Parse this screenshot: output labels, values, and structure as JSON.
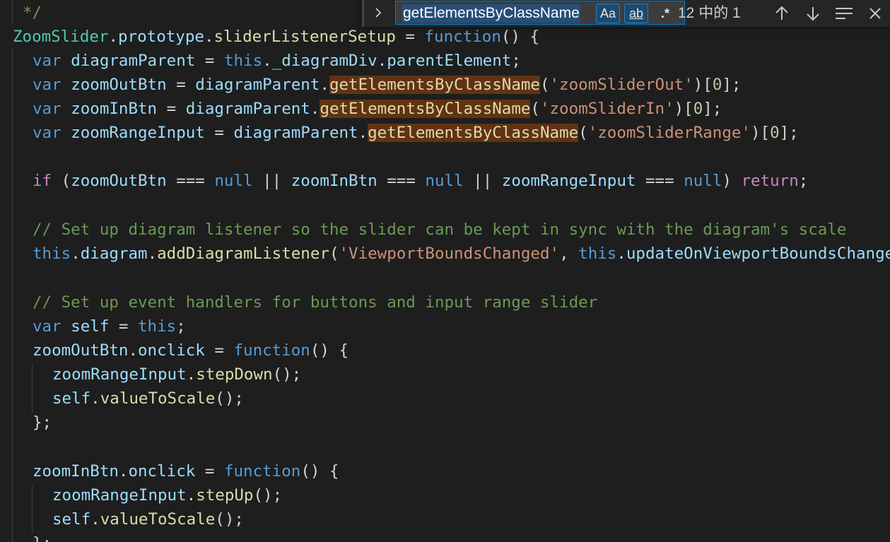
{
  "editor": {
    "lines": [
      [
        [
          "*/",
          "cmt"
        ]
      ],
      [
        [
          "ZoomSlider",
          "cls"
        ],
        [
          ".",
          "punc"
        ],
        [
          "prototype",
          "name"
        ],
        [
          ".",
          "punc"
        ],
        [
          "sliderListenerSetup",
          "fn"
        ],
        [
          " = ",
          "punc"
        ],
        [
          "function",
          "var"
        ],
        [
          "() {",
          "punc"
        ]
      ],
      [
        [
          "var",
          "var"
        ],
        [
          " ",
          "punc"
        ],
        [
          "diagramParent",
          "name"
        ],
        [
          " = ",
          "punc"
        ],
        [
          "this",
          "var"
        ],
        [
          ".",
          "punc"
        ],
        [
          "_diagramDiv",
          "name"
        ],
        [
          ".",
          "punc"
        ],
        [
          "parentElement",
          "name"
        ],
        [
          ";",
          "punc"
        ]
      ],
      [
        [
          "var",
          "var"
        ],
        [
          " ",
          "punc"
        ],
        [
          "zoomOutBtn",
          "name"
        ],
        [
          " = ",
          "punc"
        ],
        [
          "diagramParent",
          "name"
        ],
        [
          ".",
          "punc"
        ],
        [
          "getElementsByClassName",
          "fn",
          "match"
        ],
        [
          "(",
          "punc"
        ],
        [
          "'zoomSliderOut'",
          "str"
        ],
        [
          ")[",
          "punc"
        ],
        [
          "0",
          "num"
        ],
        [
          "];",
          "punc"
        ]
      ],
      [
        [
          "var",
          "var"
        ],
        [
          " ",
          "punc"
        ],
        [
          "zoomInBtn",
          "name"
        ],
        [
          " = ",
          "punc"
        ],
        [
          "diagramParent",
          "name"
        ],
        [
          ".",
          "punc"
        ],
        [
          "getElementsByClassName",
          "fn",
          "match"
        ],
        [
          "(",
          "punc"
        ],
        [
          "'zoomSliderIn'",
          "str"
        ],
        [
          ")[",
          "punc"
        ],
        [
          "0",
          "num"
        ],
        [
          "];",
          "punc"
        ]
      ],
      [
        [
          "var",
          "var"
        ],
        [
          " ",
          "punc"
        ],
        [
          "zoomRangeInput",
          "name"
        ],
        [
          " = ",
          "punc"
        ],
        [
          "diagramParent",
          "name"
        ],
        [
          ".",
          "punc"
        ],
        [
          "getElementsByClassName",
          "fn",
          "match"
        ],
        [
          "(",
          "punc"
        ],
        [
          "'zoomSliderRange'",
          "str"
        ],
        [
          ")[",
          "punc"
        ],
        [
          "0",
          "num"
        ],
        [
          "];",
          "punc"
        ]
      ],
      [],
      [
        [
          "if",
          "ctl"
        ],
        [
          " (",
          "punc"
        ],
        [
          "zoomOutBtn",
          "name"
        ],
        [
          " === ",
          "punc"
        ],
        [
          "null",
          "var"
        ],
        [
          " || ",
          "punc"
        ],
        [
          "zoomInBtn",
          "name"
        ],
        [
          " === ",
          "punc"
        ],
        [
          "null",
          "var"
        ],
        [
          " || ",
          "punc"
        ],
        [
          "zoomRangeInput",
          "name"
        ],
        [
          " === ",
          "punc"
        ],
        [
          "null",
          "var"
        ],
        [
          ") ",
          "punc"
        ],
        [
          "return",
          "ctl"
        ],
        [
          ";",
          "punc"
        ]
      ],
      [],
      [
        [
          "// Set up diagram listener so the slider can be kept in sync with the diagram's scale",
          "cmt"
        ]
      ],
      [
        [
          "this",
          "var"
        ],
        [
          ".",
          "punc"
        ],
        [
          "diagram",
          "name"
        ],
        [
          ".",
          "punc"
        ],
        [
          "addDiagramListener",
          "fn"
        ],
        [
          "(",
          "punc"
        ],
        [
          "'ViewportBoundsChanged'",
          "str"
        ],
        [
          ", ",
          "punc"
        ],
        [
          "this",
          "var"
        ],
        [
          ".",
          "punc"
        ],
        [
          "updateOnViewportBoundsChanged",
          "name"
        ]
      ],
      [],
      [
        [
          "// Set up event handlers for buttons and input range slider",
          "cmt"
        ]
      ],
      [
        [
          "var",
          "var"
        ],
        [
          " ",
          "punc"
        ],
        [
          "self",
          "name"
        ],
        [
          " = ",
          "punc"
        ],
        [
          "this",
          "var"
        ],
        [
          ";",
          "punc"
        ]
      ],
      [
        [
          "zoomOutBtn",
          "name"
        ],
        [
          ".",
          "punc"
        ],
        [
          "onclick",
          "name"
        ],
        [
          " = ",
          "punc"
        ],
        [
          "function",
          "var"
        ],
        [
          "() {",
          "punc"
        ]
      ],
      [
        [
          "zoomRangeInput",
          "name"
        ],
        [
          ".",
          "punc"
        ],
        [
          "stepDown",
          "fn"
        ],
        [
          "();",
          "punc"
        ]
      ],
      [
        [
          "self",
          "name"
        ],
        [
          ".",
          "punc"
        ],
        [
          "valueToScale",
          "fn"
        ],
        [
          "();",
          "punc"
        ]
      ],
      [
        [
          "};",
          "punc"
        ]
      ],
      [],
      [
        [
          "zoomInBtn",
          "name"
        ],
        [
          ".",
          "punc"
        ],
        [
          "onclick",
          "name"
        ],
        [
          " = ",
          "punc"
        ],
        [
          "function",
          "var"
        ],
        [
          "() {",
          "punc"
        ]
      ],
      [
        [
          "zoomRangeInput",
          "name"
        ],
        [
          ".",
          "punc"
        ],
        [
          "stepUp",
          "fn"
        ],
        [
          "();",
          "punc"
        ]
      ],
      [
        [
          "self",
          "name"
        ],
        [
          ".",
          "punc"
        ],
        [
          "valueToScale",
          "fn"
        ],
        [
          "();",
          "punc"
        ]
      ],
      [
        [
          "};",
          "punc"
        ]
      ]
    ]
  },
  "find_widget": {
    "query": "getElementsByClassName",
    "match_case_label": "Aa",
    "whole_word_label": "ab",
    "regex_label": ".*",
    "match_count": "12 中的 1"
  },
  "colors": {
    "background": "#1e1e1e",
    "keyword": "#569cd6",
    "variable": "#9cdcfe",
    "function": "#dcdcaa",
    "class": "#4ec9b0",
    "string": "#ce9178",
    "number": "#b5cea8",
    "control": "#c586c0",
    "comment": "#6a9955",
    "match_highlight": "#613214",
    "accent": "#007acc"
  },
  "icons": [
    "chevron-right-icon",
    "arrow-up-icon",
    "arrow-down-icon",
    "find-in-selection-icon",
    "close-icon"
  ]
}
